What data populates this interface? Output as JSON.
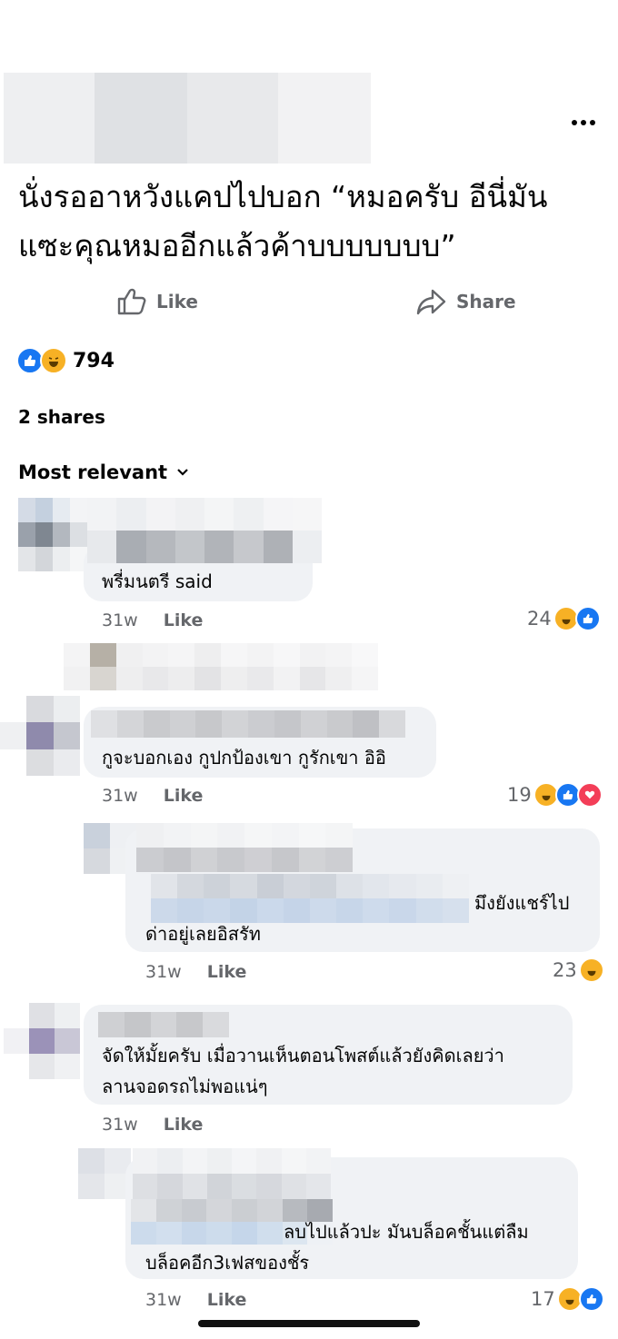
{
  "post": {
    "text_line1": "นั่งรออาหวังแคปไปบอก “หมอครับ อีนี่มัน",
    "text_line2": "แซะคุณหมออีกแล้วค้าบบบบบบบ”",
    "like_label": "Like",
    "share_label": "Share",
    "reaction_count": "794",
    "shares_text": "2 shares",
    "sort_label": "Most relevant"
  },
  "comments": [
    {
      "text": "พรี่มนตรี said",
      "time": "31w",
      "like": "Like",
      "count": "24",
      "reactions": [
        "haha",
        "like"
      ]
    },
    {
      "text": "กูจะบอกเอง กูปกป้องเขา กูรักเขา อิอิ",
      "time": "31w",
      "like": "Like",
      "count": "19",
      "reactions": [
        "haha",
        "like",
        "love"
      ]
    },
    {
      "text_a": "มึงยังแชร์ไป",
      "text_b": "ด่าอยู่เลยอิสรัท",
      "time": "31w",
      "like": "Like",
      "count": "23",
      "reactions": [
        "haha"
      ]
    },
    {
      "text_a": "จัดให้มั้ยครับ เมื่อวานเห็นตอนโพสต์แล้วยังคิดเลยว่า",
      "text_b": "ลานจอดรถไม่พอแน่ๆ",
      "time": "31w",
      "like": "Like"
    },
    {
      "text_a": "ลบไปแล้วปะ มันบล็อคชั้นแต่ลืม",
      "text_b": "บล็อคอีก3เฟสของชั้ร",
      "time": "31w",
      "like": "Like",
      "count": "17",
      "reactions": [
        "haha",
        "like"
      ]
    }
  ],
  "colors": {
    "like_blue": "#1877f2",
    "haha_yellow": "#f7b125",
    "love_red": "#f33e58",
    "bubble_bg": "#f0f2f5",
    "muted": "#65676b"
  }
}
